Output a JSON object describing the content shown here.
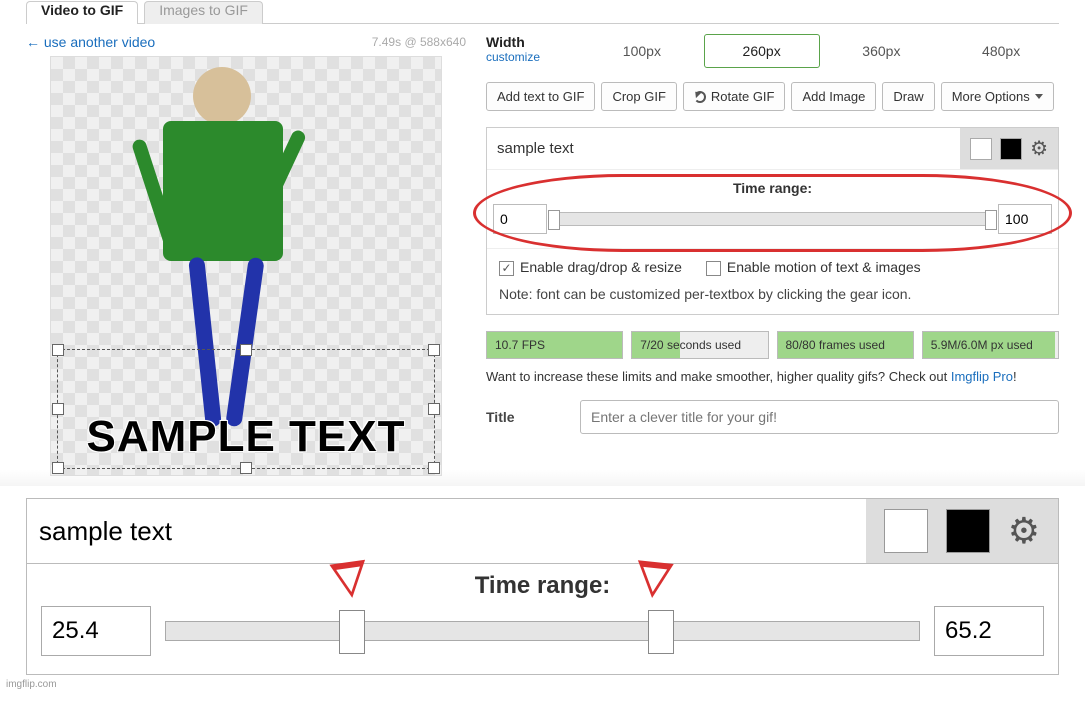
{
  "tabs": {
    "video": "Video to GIF",
    "images": "Images to GIF"
  },
  "left": {
    "use_another": "← use another video",
    "dims": "7.49s @ 588x640",
    "overlay_text": "SAMPLE TEXT"
  },
  "width": {
    "label": "Width",
    "customize": "customize",
    "opts": [
      "100px",
      "260px",
      "360px",
      "480px"
    ],
    "selected": "260px"
  },
  "toolbar": {
    "add_text": "Add text to GIF",
    "crop": "Crop GIF",
    "rotate": "Rotate GIF",
    "add_image": "Add Image",
    "draw": "Draw",
    "more": "More Options"
  },
  "textpanel": {
    "value": "sample text",
    "time_label": "Time range:",
    "time_start": "0",
    "time_end": "100",
    "opt_drag": "Enable drag/drop & resize",
    "opt_motion": "Enable motion of text & images",
    "note": "Note: font can be customized per-textbox by clicking the gear icon."
  },
  "stats": {
    "fps": "10.7 FPS",
    "seconds": "7/20 seconds used",
    "frames": "80/80 frames used",
    "px": "5.9M/6.0M px used"
  },
  "promo": {
    "pre": "Want to increase these limits and make smoother, higher quality gifs? Check out ",
    "link": "Imgflip Pro",
    "post": "!"
  },
  "title": {
    "label": "Title",
    "placeholder": "Enter a clever title for your gif!"
  },
  "zoom": {
    "value": "sample text",
    "time_label": "Time range:",
    "start": "25.4",
    "end": "65.2"
  },
  "watermark": "imgflip.com"
}
